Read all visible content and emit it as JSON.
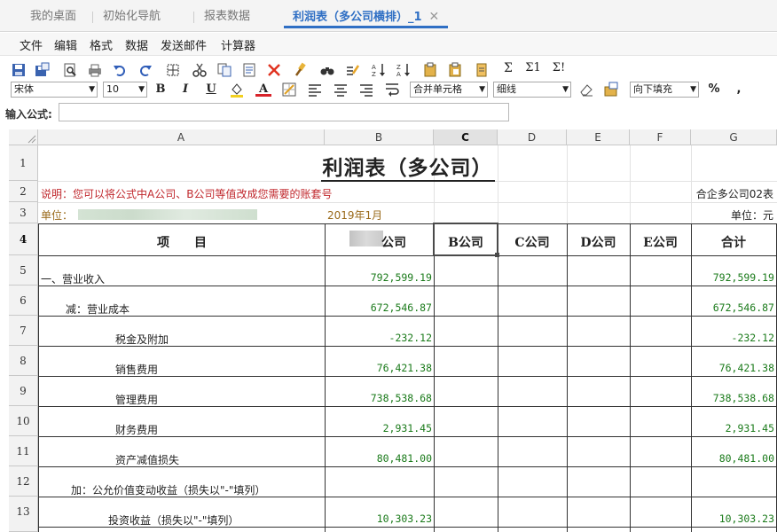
{
  "tabs": [
    {
      "label": "我的桌面"
    },
    {
      "label": "初始化导航"
    },
    {
      "label": "报表数据"
    },
    {
      "label": "利润表（多公司横排）_1"
    }
  ],
  "menu": [
    "文件",
    "编辑",
    "格式",
    "数据",
    "发送邮件",
    "计算器"
  ],
  "toolbar": {
    "font_family": "宋体",
    "font_size": "10",
    "bold": "B",
    "italic": "I",
    "underline": "U",
    "font_color_glyph": "A",
    "merge_select": "合并单元格",
    "line_select": "细线",
    "fill_select": "向下填充",
    "percent": "%",
    "comma": ",",
    "sum1": "Σ",
    "sum2": "Σ1",
    "sum3": "Σ!",
    "icons": [
      "save-icon",
      "save-as-icon",
      "print-preview-icon",
      "print-icon",
      "undo-icon",
      "redo-icon",
      "select-all-icon",
      "cut-icon",
      "copy-icon",
      "paste-icon",
      "delete-icon",
      "format-painter-icon",
      "find-icon",
      "replace-icon",
      "sort-ascending-icon",
      "sort-descending-icon",
      "paste-format-icon",
      "paste-value-icon",
      "clipboard-icon"
    ]
  },
  "formula": {
    "label": "输入公式:",
    "value": ""
  },
  "columns": [
    "A",
    "B",
    "C",
    "D",
    "E",
    "F",
    "G"
  ],
  "rows": [
    "1",
    "2",
    "3",
    "4",
    "5",
    "6",
    "7",
    "8",
    "9",
    "10",
    "11",
    "12",
    "13"
  ],
  "sheet": {
    "title": "利润表（多公司）",
    "note": "说明：您可以将公式中A公司、B公司等值改成您需要的账套号",
    "template_name": "合企多公司02表",
    "unit_label": "单位：",
    "period": "2019年1月",
    "unit_right": "单位：元",
    "headers": {
      "item": "项　　目",
      "a": "公司",
      "b": "B公司",
      "c": "C公司",
      "d": "D公司",
      "e": "E公司",
      "total": "合计"
    },
    "lines": [
      {
        "label": "一、营业收入",
        "a": "792,599.19",
        "total": "792,599.19"
      },
      {
        "label": "减：营业成本",
        "a": "672,546.87",
        "total": "672,546.87"
      },
      {
        "label": "税金及附加",
        "a": "-232.12",
        "total": "-232.12"
      },
      {
        "label": "销售费用",
        "a": "76,421.38",
        "total": "76,421.38"
      },
      {
        "label": "管理费用",
        "a": "738,538.68",
        "total": "738,538.68"
      },
      {
        "label": "财务费用",
        "a": "2,931.45",
        "total": "2,931.45"
      },
      {
        "label": "资产减值损失",
        "a": "80,481.00",
        "total": "80,481.00"
      },
      {
        "label": "加：公允价值变动收益（损失以\"-\"填列）",
        "a": "",
        "total": ""
      },
      {
        "label": "投资收益（损失以\"-\"填列）",
        "a": "10,303.23",
        "total": "10,303.23"
      }
    ]
  },
  "colors": {
    "accent": "#2f6fc4",
    "value_green": "#1a7a1a",
    "note_red": "#c0282d"
  }
}
